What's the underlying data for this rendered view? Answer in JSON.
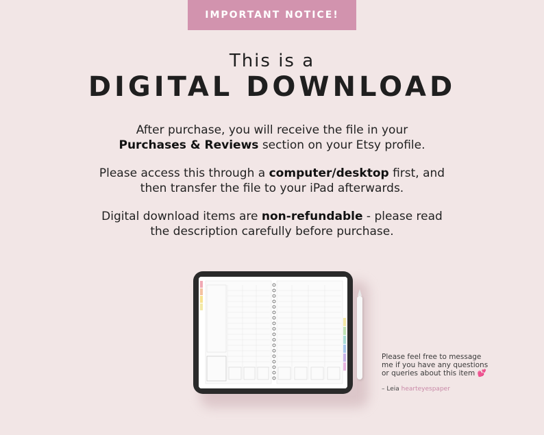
{
  "banner": {
    "label": "IMPORTANT NOTICE!"
  },
  "headline": {
    "line1": "This is a",
    "line2": "DIGITAL DOWNLOAD"
  },
  "paragraphs": {
    "p1": {
      "line1": "After purchase, you will receive the file in your",
      "bold": "Purchases & Reviews",
      "rest": " section on your Etsy profile."
    },
    "p2": {
      "pre": "Please access this through a ",
      "bold": "computer/desktop",
      "post": " first, and",
      "line2": "then transfer the file to your iPad afterwards."
    },
    "p3": {
      "pre": "Digital download items are ",
      "bold": "non-refundable",
      "post": " - please read",
      "line2": "the description carefully before purchase."
    }
  },
  "note": {
    "line1": "Please feel free to message",
    "line2": "me if you have any questions",
    "line3": "or queries about this item",
    "emoji": "💕"
  },
  "signature": {
    "prefix": "– Leia ",
    "handle": "hearteyespaper"
  },
  "colors": {
    "background": "#f2e6e6",
    "accent": "#d293ae",
    "handle": "#c98aa8"
  }
}
